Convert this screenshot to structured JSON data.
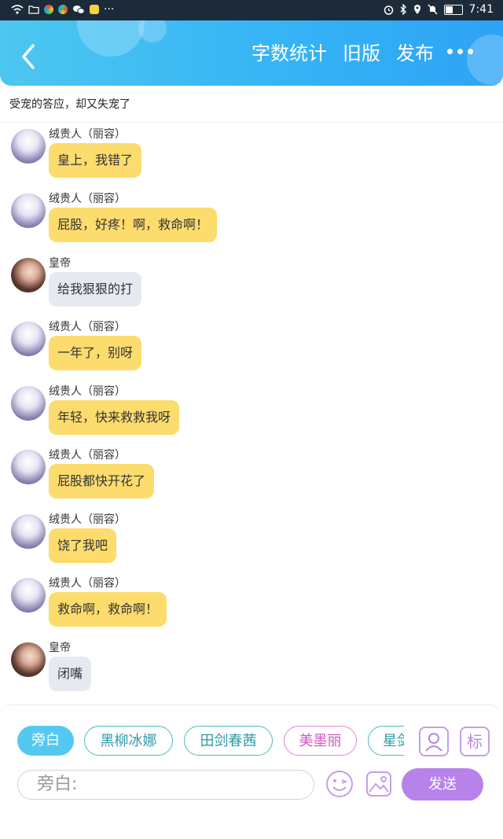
{
  "status_bar": {
    "time": "7:41",
    "more": "···"
  },
  "header": {
    "actions": [
      "字数统计",
      "旧版",
      "发布"
    ]
  },
  "story": {
    "subtitle": "受宠的答应，却又失宠了"
  },
  "messages": [
    {
      "speaker": "绒贵人（丽容）",
      "text": "皇上，我错了",
      "style": "yellow",
      "avatar": "princess"
    },
    {
      "speaker": "绒贵人（丽容）",
      "text": "屁股，好疼！啊，救命啊！",
      "style": "yellow",
      "avatar": "princess"
    },
    {
      "speaker": "皇帝",
      "text": "给我狠狠的打",
      "style": "gray",
      "avatar": "emperor"
    },
    {
      "speaker": "绒贵人（丽容）",
      "text": "一年了，别呀",
      "style": "yellow",
      "avatar": "princess"
    },
    {
      "speaker": "绒贵人（丽容）",
      "text": "年轻，快来救救我呀",
      "style": "yellow",
      "avatar": "princess"
    },
    {
      "speaker": "绒贵人（丽容）",
      "text": "屁股都快开花了",
      "style": "yellow",
      "avatar": "princess"
    },
    {
      "speaker": "绒贵人（丽容）",
      "text": "饶了我吧",
      "style": "yellow",
      "avatar": "princess"
    },
    {
      "speaker": "绒贵人（丽容）",
      "text": "救命啊，救命啊！",
      "style": "yellow",
      "avatar": "princess"
    },
    {
      "speaker": "皇帝",
      "text": "闭嘴",
      "style": "gray",
      "avatar": "emperor"
    }
  ],
  "composer": {
    "characters": [
      "旁白",
      "黑柳冰娜",
      "田剑春茜",
      "美墨丽",
      "星剑"
    ],
    "selected": "旁白",
    "tag_label": "标",
    "input_placeholder": "旁白:",
    "send_label": "发送"
  },
  "colors": {
    "header_start": "#4dc7f0",
    "header_end": "#2ea3f5",
    "bubble_yellow": "#fddc6e",
    "bubble_gray": "#e6eaf0",
    "send_button": "#b782ea",
    "chip_active": "#55c8f2"
  }
}
